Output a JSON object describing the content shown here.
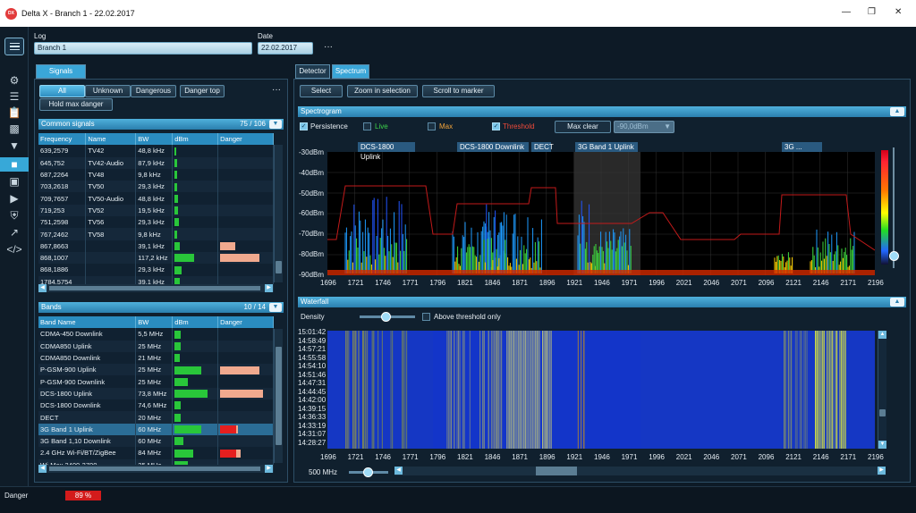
{
  "window": {
    "title": "Delta X - Branch 1 - 22.02.2017",
    "logo_text": "DX"
  },
  "log": {
    "label": "Log",
    "value": "Branch 1"
  },
  "date": {
    "label": "Date",
    "value": "22.02.2017",
    "more": "···"
  },
  "sidebar": {
    "icons": [
      "menu-icon",
      "gear-icon",
      "list-icon",
      "clipboard-icon",
      "bar-chart-icon",
      "wifi-icon",
      "spectrum-icon",
      "image-icon",
      "play-icon",
      "shield-icon",
      "trend-icon",
      "code-icon"
    ],
    "active": 6
  },
  "signals": {
    "tab": "Signals",
    "filters": [
      "All",
      "Unknown",
      "Dangerous"
    ],
    "active_filter": "All",
    "danger_top": "Danger top",
    "hold_max": "Hold max danger",
    "more": "···"
  },
  "common": {
    "title": "Common signals",
    "count": "75 / 106",
    "columns": [
      "Frequency",
      "Name",
      "BW",
      "dBm",
      "Danger"
    ],
    "rows": [
      [
        "639,2579",
        "TV42",
        "48,8 kHz",
        0.04,
        0
      ],
      [
        "645,752",
        "TV42-Audio",
        "87,9 kHz",
        0.06,
        0
      ],
      [
        "687,2264",
        "TV48",
        "9,8 kHz",
        0.05,
        0
      ],
      [
        "703,2618",
        "TV50",
        "29,3 kHz",
        0.06,
        0
      ],
      [
        "709,7657",
        "TV50-Audio",
        "48,8 kHz",
        0.08,
        0
      ],
      [
        "719,253",
        "TV52",
        "19,5 kHz",
        0.08,
        0
      ],
      [
        "751,2598",
        "TV56",
        "29,3 kHz",
        0.1,
        0
      ],
      [
        "767,2462",
        "TV58",
        "9,8 kHz",
        0.06,
        0
      ],
      [
        "867,8663",
        "",
        "39,1 kHz",
        0.12,
        0.3
      ],
      [
        "868,1007",
        "",
        "117,2 kHz",
        0.45,
        0.75
      ],
      [
        "868,1886",
        "",
        "29,3 kHz",
        0.16,
        0
      ],
      [
        "1784,5754",
        "",
        "39,1 kHz",
        0.12,
        0
      ]
    ]
  },
  "bands": {
    "title": "Bands",
    "count": "10 / 14",
    "columns": [
      "Band Name",
      "BW",
      "dBm",
      "Danger"
    ],
    "rows": [
      [
        "CDMA-450 Downlink",
        "5,5 MHz",
        0.14,
        0,
        0
      ],
      [
        "CDMA850 Uplink",
        "25 MHz",
        0.14,
        0,
        0
      ],
      [
        "CDMA850 Downlink",
        "21 MHz",
        0.12,
        0,
        0
      ],
      [
        "P-GSM-900 Uplink",
        "25 MHz",
        0.6,
        0.75,
        0
      ],
      [
        "P-GSM-900 Downlink",
        "25 MHz",
        0.3,
        0,
        0
      ],
      [
        "DCS-1800 Uplink",
        "73,8 MHz",
        0.75,
        0.82,
        0
      ],
      [
        "DCS-1800 Downlink",
        "74,6 MHz",
        0.14,
        0,
        0
      ],
      [
        "DECT",
        "20 MHz",
        0.14,
        0,
        0
      ],
      [
        "3G Band 1 Uplink",
        "60 MHz",
        0.6,
        0.35,
        1
      ],
      [
        "3G Band 1,10 Downlink",
        "60 MHz",
        0.2,
        0,
        0
      ],
      [
        "2.4 GHz Wi-Fi/BT/ZigBee",
        "84 MHz",
        0.42,
        0.4,
        1
      ],
      [
        "Wi-Max 3400-3700",
        "25 MHz",
        0.3,
        0,
        0
      ]
    ],
    "selected": 8
  },
  "right": {
    "tabs": [
      "Detector",
      "Spectrum"
    ],
    "active_tab": "Spectrum",
    "actions": [
      "Select",
      "Zoom in selection",
      "Scroll to marker"
    ]
  },
  "spectrogram": {
    "title": "Spectrogram",
    "options": [
      "Persistence",
      "Live",
      "Max",
      "Threshold"
    ],
    "checked": [
      true,
      false,
      false,
      true
    ],
    "max_clear": "Max clear",
    "threshold_value": "-90,0dBm",
    "y_ticks": [
      "-30dBm",
      "-40dBm",
      "-50dBm",
      "-60dBm",
      "-70dBm",
      "-80dBm",
      "-90dBm"
    ],
    "band_labels": [
      "DCS-1800 Uplink",
      "DCS-1800 Downlink",
      "DECT",
      "3G Band 1 Uplink",
      "3G ..."
    ]
  },
  "x_ticks": [
    "1696",
    "1721",
    "1746",
    "1771",
    "1796",
    "1821",
    "1846",
    "1871",
    "1896",
    "1921",
    "1946",
    "1971",
    "1996",
    "2021",
    "2046",
    "2071",
    "2096",
    "2121",
    "2146",
    "2171",
    "2196"
  ],
  "waterfall": {
    "title": "Waterfall",
    "density": "Density",
    "above": "Above threshold only",
    "times": [
      "15:01:42",
      "14:58:49",
      "14:57:21",
      "14:55:58",
      "14:54:10",
      "14:51:46",
      "14:47:31",
      "14:44:45",
      "14:42:00",
      "14:39:15",
      "14:36:33",
      "14:33:19",
      "14:31:07",
      "14:28:27"
    ],
    "zoom": "500 MHz"
  },
  "status": {
    "label": "Danger",
    "value": "89 %",
    "level": 0.89
  },
  "colors": {
    "accent": "#3aa6d8",
    "danger_red": "#e51f1f",
    "green": "#29c63a"
  }
}
